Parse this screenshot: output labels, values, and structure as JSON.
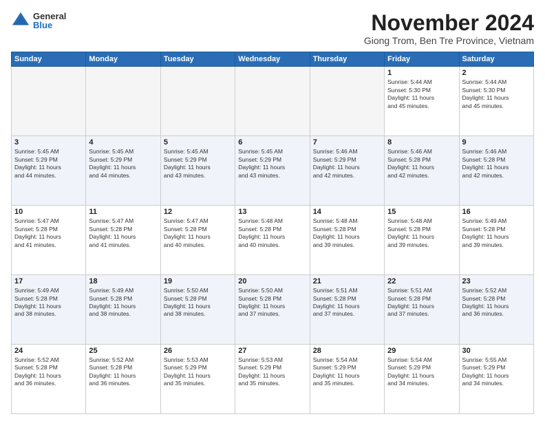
{
  "logo": {
    "general": "General",
    "blue": "Blue"
  },
  "title": "November 2024",
  "location": "Giong Trom, Ben Tre Province, Vietnam",
  "days_of_week": [
    "Sunday",
    "Monday",
    "Tuesday",
    "Wednesday",
    "Thursday",
    "Friday",
    "Saturday"
  ],
  "weeks": [
    [
      {
        "day": "",
        "info": "",
        "empty": true
      },
      {
        "day": "",
        "info": "",
        "empty": true
      },
      {
        "day": "",
        "info": "",
        "empty": true
      },
      {
        "day": "",
        "info": "",
        "empty": true
      },
      {
        "day": "",
        "info": "",
        "empty": true
      },
      {
        "day": "1",
        "info": "Sunrise: 5:44 AM\nSunset: 5:30 PM\nDaylight: 11 hours\nand 45 minutes."
      },
      {
        "day": "2",
        "info": "Sunrise: 5:44 AM\nSunset: 5:30 PM\nDaylight: 11 hours\nand 45 minutes."
      }
    ],
    [
      {
        "day": "3",
        "info": "Sunrise: 5:45 AM\nSunset: 5:29 PM\nDaylight: 11 hours\nand 44 minutes."
      },
      {
        "day": "4",
        "info": "Sunrise: 5:45 AM\nSunset: 5:29 PM\nDaylight: 11 hours\nand 44 minutes."
      },
      {
        "day": "5",
        "info": "Sunrise: 5:45 AM\nSunset: 5:29 PM\nDaylight: 11 hours\nand 43 minutes."
      },
      {
        "day": "6",
        "info": "Sunrise: 5:45 AM\nSunset: 5:29 PM\nDaylight: 11 hours\nand 43 minutes."
      },
      {
        "day": "7",
        "info": "Sunrise: 5:46 AM\nSunset: 5:29 PM\nDaylight: 11 hours\nand 42 minutes."
      },
      {
        "day": "8",
        "info": "Sunrise: 5:46 AM\nSunset: 5:28 PM\nDaylight: 11 hours\nand 42 minutes."
      },
      {
        "day": "9",
        "info": "Sunrise: 5:46 AM\nSunset: 5:28 PM\nDaylight: 11 hours\nand 42 minutes."
      }
    ],
    [
      {
        "day": "10",
        "info": "Sunrise: 5:47 AM\nSunset: 5:28 PM\nDaylight: 11 hours\nand 41 minutes."
      },
      {
        "day": "11",
        "info": "Sunrise: 5:47 AM\nSunset: 5:28 PM\nDaylight: 11 hours\nand 41 minutes."
      },
      {
        "day": "12",
        "info": "Sunrise: 5:47 AM\nSunset: 5:28 PM\nDaylight: 11 hours\nand 40 minutes."
      },
      {
        "day": "13",
        "info": "Sunrise: 5:48 AM\nSunset: 5:28 PM\nDaylight: 11 hours\nand 40 minutes."
      },
      {
        "day": "14",
        "info": "Sunrise: 5:48 AM\nSunset: 5:28 PM\nDaylight: 11 hours\nand 39 minutes."
      },
      {
        "day": "15",
        "info": "Sunrise: 5:48 AM\nSunset: 5:28 PM\nDaylight: 11 hours\nand 39 minutes."
      },
      {
        "day": "16",
        "info": "Sunrise: 5:49 AM\nSunset: 5:28 PM\nDaylight: 11 hours\nand 39 minutes."
      }
    ],
    [
      {
        "day": "17",
        "info": "Sunrise: 5:49 AM\nSunset: 5:28 PM\nDaylight: 11 hours\nand 38 minutes."
      },
      {
        "day": "18",
        "info": "Sunrise: 5:49 AM\nSunset: 5:28 PM\nDaylight: 11 hours\nand 38 minutes."
      },
      {
        "day": "19",
        "info": "Sunrise: 5:50 AM\nSunset: 5:28 PM\nDaylight: 11 hours\nand 38 minutes."
      },
      {
        "day": "20",
        "info": "Sunrise: 5:50 AM\nSunset: 5:28 PM\nDaylight: 11 hours\nand 37 minutes."
      },
      {
        "day": "21",
        "info": "Sunrise: 5:51 AM\nSunset: 5:28 PM\nDaylight: 11 hours\nand 37 minutes."
      },
      {
        "day": "22",
        "info": "Sunrise: 5:51 AM\nSunset: 5:28 PM\nDaylight: 11 hours\nand 37 minutes."
      },
      {
        "day": "23",
        "info": "Sunrise: 5:52 AM\nSunset: 5:28 PM\nDaylight: 11 hours\nand 36 minutes."
      }
    ],
    [
      {
        "day": "24",
        "info": "Sunrise: 5:52 AM\nSunset: 5:28 PM\nDaylight: 11 hours\nand 36 minutes."
      },
      {
        "day": "25",
        "info": "Sunrise: 5:52 AM\nSunset: 5:28 PM\nDaylight: 11 hours\nand 36 minutes."
      },
      {
        "day": "26",
        "info": "Sunrise: 5:53 AM\nSunset: 5:29 PM\nDaylight: 11 hours\nand 35 minutes."
      },
      {
        "day": "27",
        "info": "Sunrise: 5:53 AM\nSunset: 5:29 PM\nDaylight: 11 hours\nand 35 minutes."
      },
      {
        "day": "28",
        "info": "Sunrise: 5:54 AM\nSunset: 5:29 PM\nDaylight: 11 hours\nand 35 minutes."
      },
      {
        "day": "29",
        "info": "Sunrise: 5:54 AM\nSunset: 5:29 PM\nDaylight: 11 hours\nand 34 minutes."
      },
      {
        "day": "30",
        "info": "Sunrise: 5:55 AM\nSunset: 5:29 PM\nDaylight: 11 hours\nand 34 minutes."
      }
    ]
  ]
}
